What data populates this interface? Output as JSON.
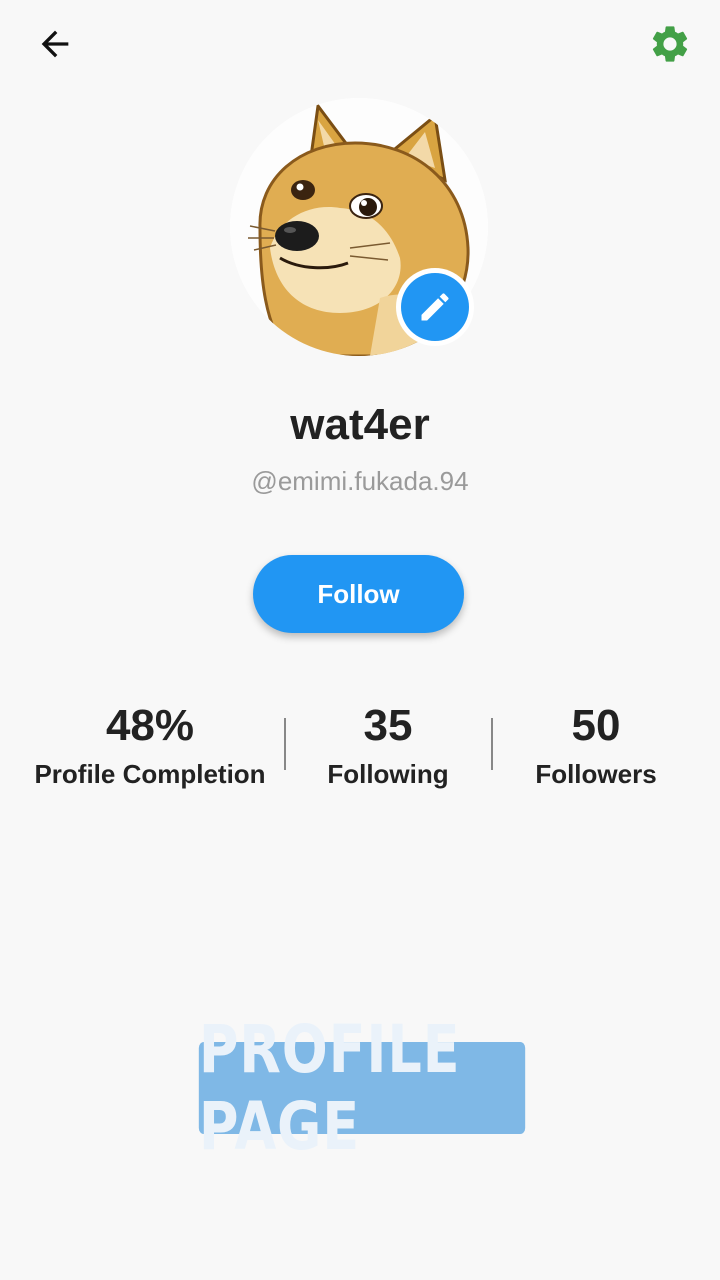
{
  "header": {
    "back_icon": "arrow-left-icon",
    "settings_icon": "gear-icon"
  },
  "profile": {
    "avatar_icon": "doge-avatar",
    "edit_icon": "pencil-icon",
    "name": "wat4er",
    "handle": "@emimi.fukada.94",
    "follow_label": "Follow"
  },
  "stats": [
    {
      "value": "48%",
      "label": "Profile Completion"
    },
    {
      "value": "35",
      "label": "Following"
    },
    {
      "value": "50",
      "label": "Followers"
    }
  ],
  "profile_completion_fraction": 0.48,
  "overlay": {
    "text": "PROFILE PAGE"
  },
  "colors": {
    "accent": "#2196f3",
    "settings": "#43a047",
    "overlay_bg": "#7fb8e6",
    "background": "#f8f8f8"
  }
}
